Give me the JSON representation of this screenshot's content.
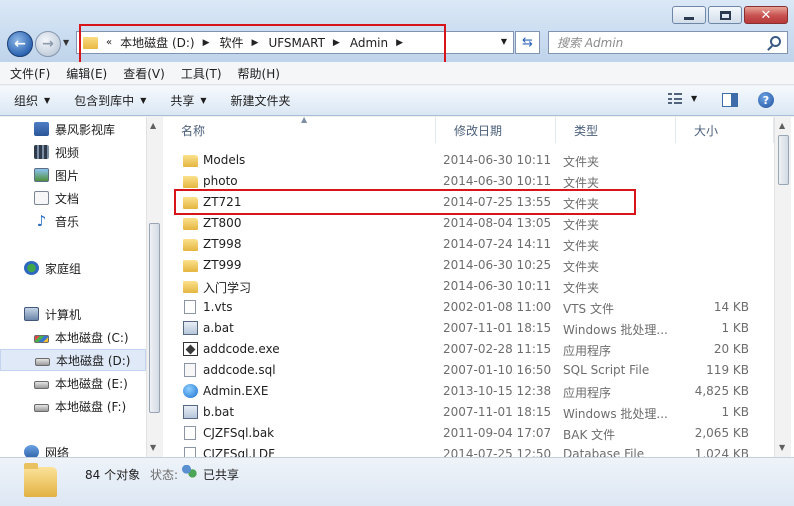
{
  "address": {
    "lead": "«",
    "crumbs": [
      "本地磁盘 (D:)",
      "软件",
      "UFSMART",
      "Admin"
    ]
  },
  "search": {
    "placeholder": "搜索 Admin"
  },
  "menu": [
    "文件(F)",
    "编辑(E)",
    "查看(V)",
    "工具(T)",
    "帮助(H)"
  ],
  "toolbar": {
    "organize": "组织",
    "include_library": "包含到库中",
    "share": "共享",
    "new_folder": "新建文件夹"
  },
  "nav": {
    "items": [
      {
        "label": "暴风影视库",
        "icon": "library-icon"
      },
      {
        "label": "视频",
        "icon": "video-icon"
      },
      {
        "label": "图片",
        "icon": "picture-icon"
      },
      {
        "label": "文档",
        "icon": "document-icon"
      },
      {
        "label": "音乐",
        "icon": "music-icon"
      },
      {
        "label": "家庭组",
        "icon": "homegroup-icon"
      },
      {
        "label": "计算机",
        "icon": "computer-icon"
      },
      {
        "label": "本地磁盘 (C:)",
        "icon": "drive-c-icon"
      },
      {
        "label": "本地磁盘 (D:)",
        "icon": "drive-icon",
        "selected": true
      },
      {
        "label": "本地磁盘 (E:)",
        "icon": "drive-icon"
      },
      {
        "label": "本地磁盘 (F:)",
        "icon": "drive-icon"
      },
      {
        "label": "网络",
        "icon": "network-icon"
      }
    ]
  },
  "columns": {
    "name": "名称",
    "date": "修改日期",
    "type": "类型",
    "size": "大小"
  },
  "files": [
    {
      "name": "Models",
      "date": "2014-06-30 10:11",
      "type": "文件夹",
      "size": "",
      "icon": "folder"
    },
    {
      "name": "photo",
      "date": "2014-06-30 10:11",
      "type": "文件夹",
      "size": "",
      "icon": "folder"
    },
    {
      "name": "ZT721",
      "date": "2014-07-25 13:55",
      "type": "文件夹",
      "size": "",
      "icon": "folder"
    },
    {
      "name": "ZT800",
      "date": "2014-08-04 13:05",
      "type": "文件夹",
      "size": "",
      "icon": "folder"
    },
    {
      "name": "ZT998",
      "date": "2014-07-24 14:11",
      "type": "文件夹",
      "size": "",
      "icon": "folder"
    },
    {
      "name": "ZT999",
      "date": "2014-06-30 10:25",
      "type": "文件夹",
      "size": "",
      "icon": "folder"
    },
    {
      "name": "入门学习",
      "date": "2014-06-30 10:11",
      "type": "文件夹",
      "size": "",
      "icon": "folder"
    },
    {
      "name": "1.vts",
      "date": "2002-01-08 11:00",
      "type": "VTS 文件",
      "size": "14 KB",
      "icon": "file"
    },
    {
      "name": "a.bat",
      "date": "2007-11-01 18:15",
      "type": "Windows 批处理...",
      "size": "1 KB",
      "icon": "bat"
    },
    {
      "name": "addcode.exe",
      "date": "2007-02-28 11:15",
      "type": "应用程序",
      "size": "20 KB",
      "icon": "exe"
    },
    {
      "name": "addcode.sql",
      "date": "2007-01-10 16:50",
      "type": "SQL Script File",
      "size": "119 KB",
      "icon": "sql"
    },
    {
      "name": "Admin.EXE",
      "date": "2013-10-15 12:38",
      "type": "应用程序",
      "size": "4,825 KB",
      "icon": "admin"
    },
    {
      "name": "b.bat",
      "date": "2007-11-01 18:15",
      "type": "Windows 批处理...",
      "size": "1 KB",
      "icon": "bat"
    },
    {
      "name": "CJZFSql.bak",
      "date": "2011-09-04 17:07",
      "type": "BAK 文件",
      "size": "2,065 KB",
      "icon": "file"
    },
    {
      "name": "CJZFSql.LDF",
      "date": "2014-07-25 12:50",
      "type": "Database File",
      "size": "1,024 KB",
      "icon": "file"
    }
  ],
  "details": {
    "count": "84 个对象",
    "state_label": "状态:",
    "state": "已共享"
  }
}
